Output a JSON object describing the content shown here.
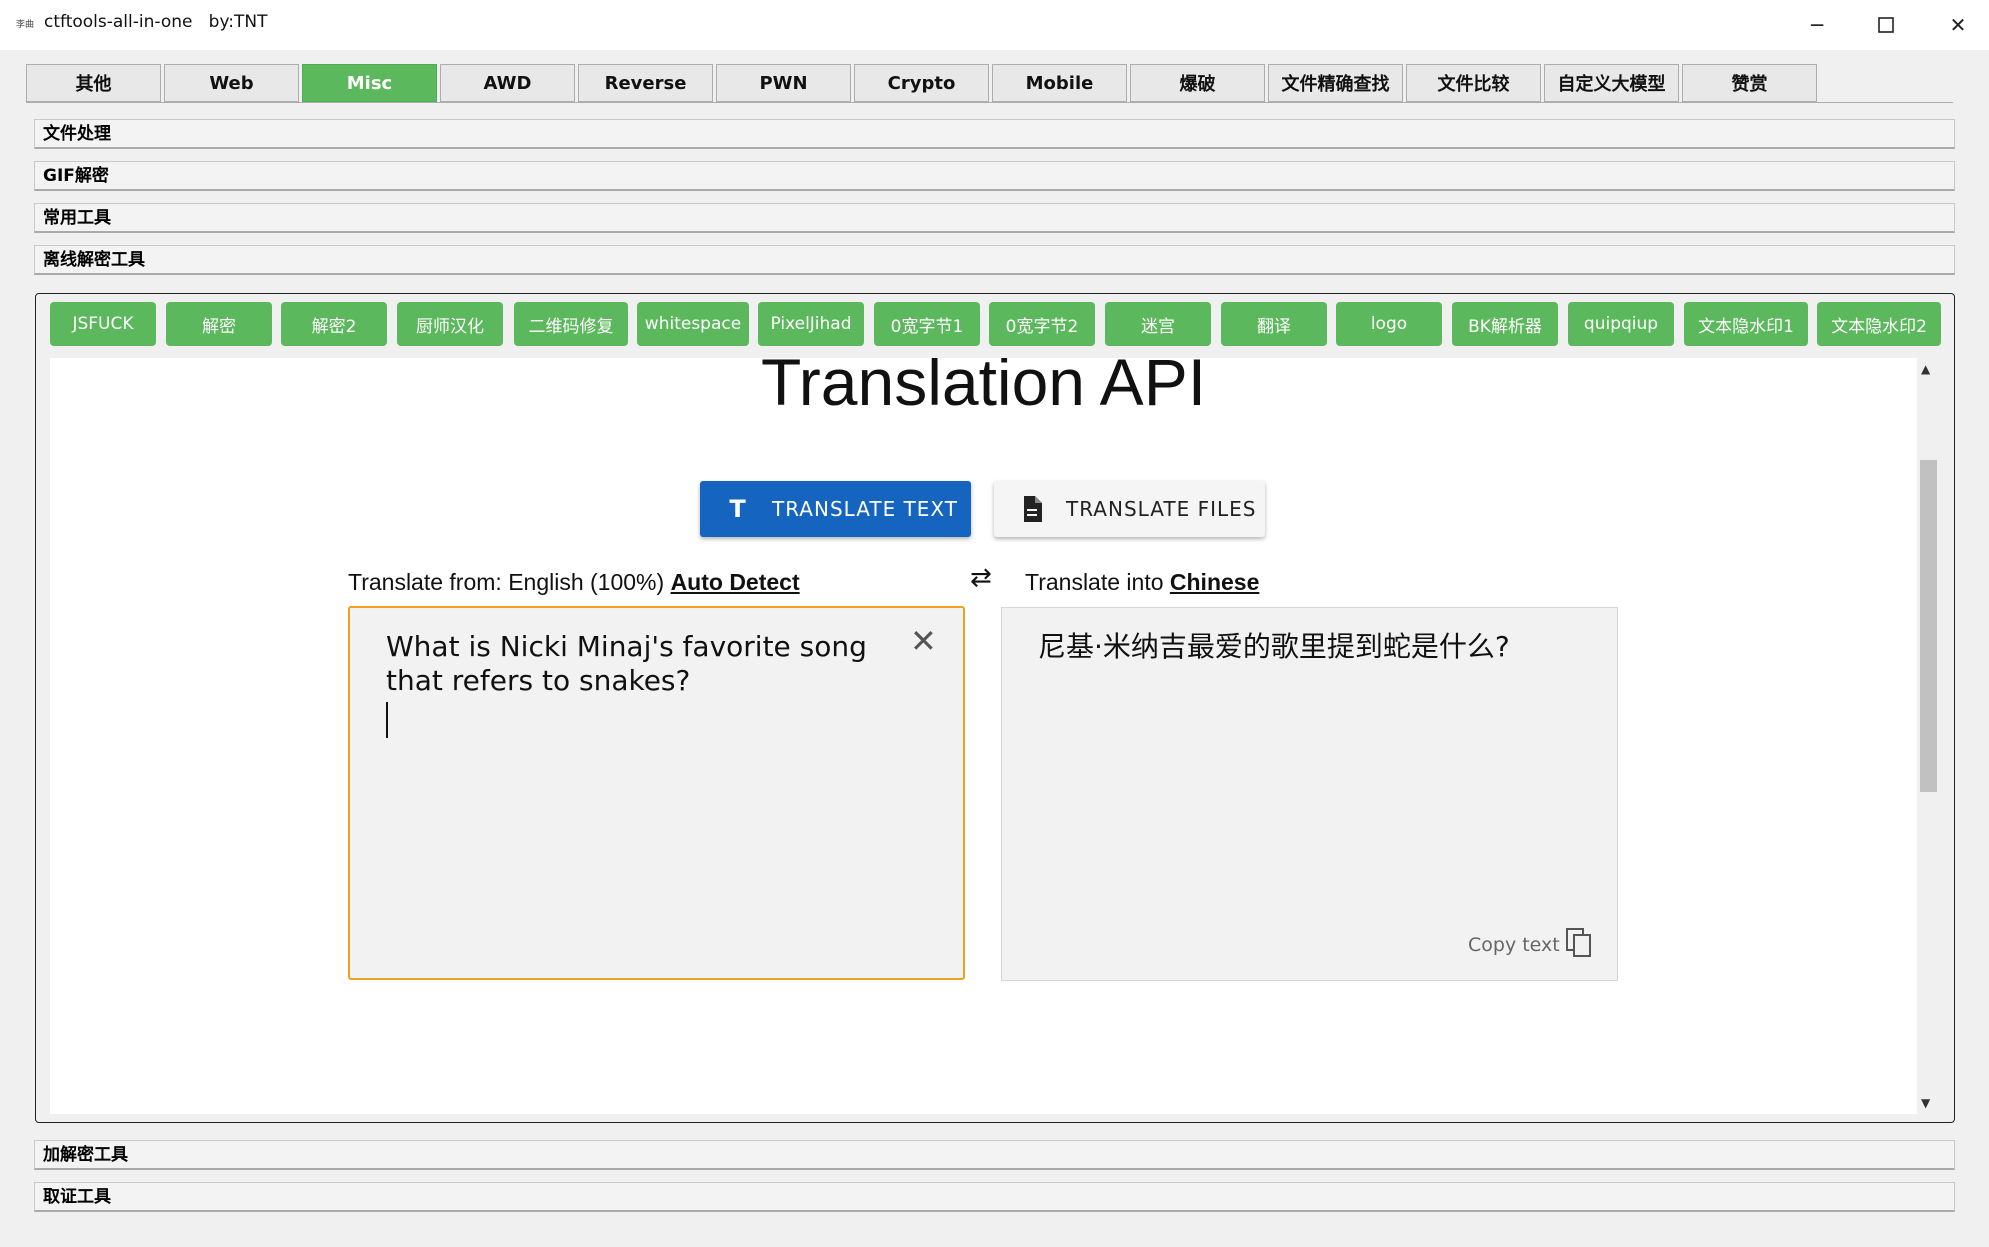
{
  "window": {
    "icon_text": "李曲",
    "title": "ctftools-all-in-one   by:TNT"
  },
  "tabs": [
    "其他",
    "Web",
    "Misc",
    "AWD",
    "Reverse",
    "PWN",
    "Crypto",
    "Mobile",
    "爆破",
    "文件精确查找",
    "文件比较",
    "自定义大模型",
    "赞赏"
  ],
  "active_tab": "Misc",
  "accordion_top": [
    "文件处理",
    "GIF解密",
    "常用工具",
    "离线解密工具"
  ],
  "accordion_bottom": [
    "加解密工具",
    "取证工具"
  ],
  "tools": [
    "JSFUCK",
    "解密",
    "解密2",
    "厨师汉化",
    "二维码修复",
    "whitespace",
    "PixelJihad",
    "0宽字节1",
    "0宽字节2",
    "迷宫",
    "翻译",
    "logo",
    "BK解析器",
    "quipqiup",
    "文本隐水印1",
    "文本隐水印2"
  ],
  "translator": {
    "heading": "Translation API",
    "translate_text_label": "TRANSLATE TEXT",
    "translate_files_label": "TRANSLATE FILES",
    "from_prefix": "Translate from: English (100%)",
    "from_link": "Auto Detect",
    "into_prefix": "Translate into",
    "into_link": "Chinese",
    "source_text": "What is Nicki Minaj's favorite song that refers to snakes?",
    "result_text": "尼基·米纳吉最爱的歌里提到蛇是什么?",
    "copy_label": "Copy text"
  },
  "colors": {
    "tab_active": "#5cb85c",
    "tool_button": "#5cb85c",
    "primary_button": "#1565c0",
    "input_focus_border": "#f0a020"
  }
}
